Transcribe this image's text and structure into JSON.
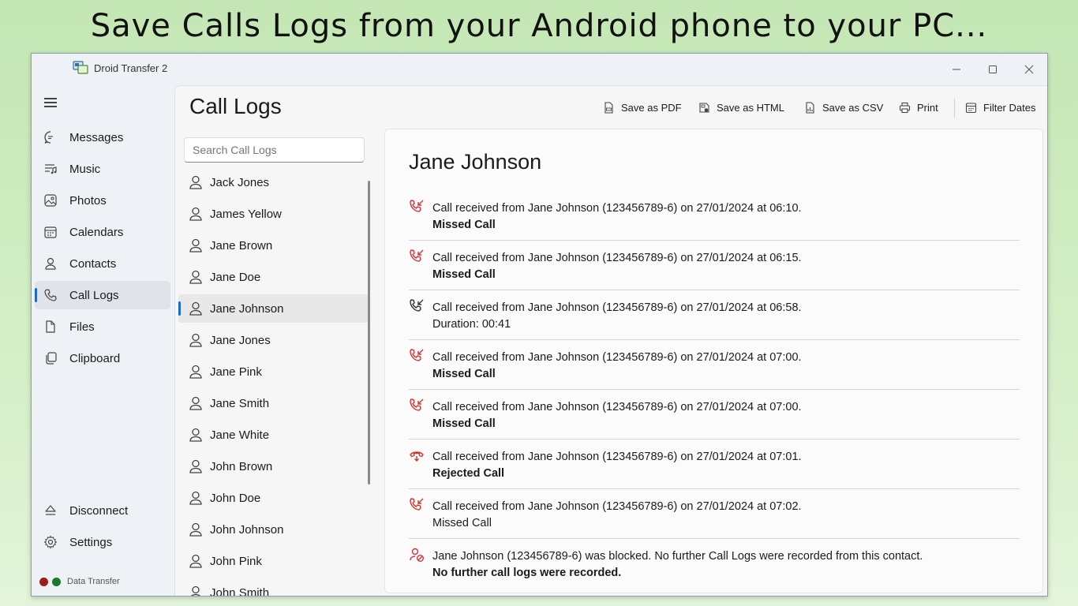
{
  "headline": "Save Calls Logs from your Android phone to your PC...",
  "window": {
    "title": "Droid Transfer 2",
    "controls": {
      "minimize": "—",
      "maximize": "☐",
      "close": "✕"
    }
  },
  "sidebar": {
    "items": [
      {
        "label": "Messages",
        "icon": "message-icon"
      },
      {
        "label": "Music",
        "icon": "music-icon"
      },
      {
        "label": "Photos",
        "icon": "photo-icon"
      },
      {
        "label": "Calendars",
        "icon": "calendar-icon"
      },
      {
        "label": "Contacts",
        "icon": "contact-icon"
      },
      {
        "label": "Call Logs",
        "icon": "phone-icon",
        "active": true
      },
      {
        "label": "Files",
        "icon": "file-icon"
      },
      {
        "label": "Clipboard",
        "icon": "clipboard-icon"
      }
    ],
    "bottom": [
      {
        "label": "Disconnect",
        "icon": "eject-icon"
      },
      {
        "label": "Settings",
        "icon": "gear-icon"
      }
    ],
    "status": {
      "label": "Data Transfer",
      "dot_colors": [
        "#9e1b1b",
        "#1a7a2a"
      ]
    }
  },
  "page": {
    "title": "Call Logs"
  },
  "toolbar": {
    "save_pdf": "Save as PDF",
    "save_html": "Save as HTML",
    "save_csv": "Save as CSV",
    "print": "Print",
    "filter_dates": "Filter Dates"
  },
  "search": {
    "placeholder": "Search Call Logs"
  },
  "contacts": [
    "Jack Jones",
    "James Yellow",
    "Jane Brown",
    "Jane Doe",
    "Jane Johnson",
    "Jane Jones",
    "Jane Pink",
    "Jane Smith",
    "Jane White",
    "John Brown",
    "John Doe",
    "John Johnson",
    "John Pink",
    "John Smith"
  ],
  "selected_contact_index": 4,
  "detail": {
    "name": "Jane Johnson",
    "logs": [
      {
        "type": "missed",
        "text": "Call received from Jane Johnson (123456789-6) on 27/01/2024 at 06:10.",
        "sub": "Missed Call",
        "bold": true
      },
      {
        "type": "missed",
        "text": "Call received from Jane Johnson (123456789-6) on 27/01/2024 at 06:15.",
        "sub": "Missed Call",
        "bold": true
      },
      {
        "type": "received",
        "text": "Call received from Jane Johnson (123456789-6) on 27/01/2024 at 06:58.",
        "sub": "Duration: 00:41",
        "bold": false
      },
      {
        "type": "missed",
        "text": "Call received from Jane Johnson (123456789-6) on 27/01/2024 at 07:00.",
        "sub": "Missed Call",
        "bold": true
      },
      {
        "type": "missed",
        "text": "Call received from Jane Johnson (123456789-6) on 27/01/2024 at 07:00.",
        "sub": "Missed Call",
        "bold": true
      },
      {
        "type": "rejected",
        "text": "Call received from Jane Johnson (123456789-6) on 27/01/2024 at 07:01.",
        "sub": "Rejected Call",
        "bold": true
      },
      {
        "type": "missed",
        "text": "Call received from Jane Johnson (123456789-6) on 27/01/2024 at 07:02.",
        "sub": "Missed Call",
        "bold": false
      },
      {
        "type": "blocked",
        "text": "Jane Johnson (123456789-6) was blocked. No further Call Logs were recorded from this contact.",
        "sub": "No further call logs were recorded.",
        "bold": true
      }
    ]
  },
  "colors": {
    "missed": "#d13438",
    "received": "#333333",
    "accent": "#1a6ad0"
  }
}
